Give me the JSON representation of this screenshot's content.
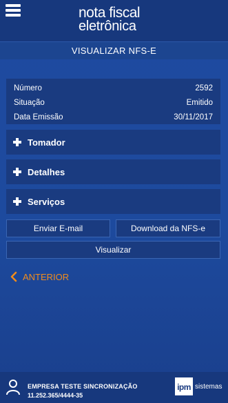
{
  "header": {
    "logo_line1": "nota fiscal",
    "logo_line2": "eletrônica"
  },
  "subheader": {
    "title": "VISUALIZAR NFS-E"
  },
  "info": [
    {
      "label": "Número",
      "value": "2592"
    },
    {
      "label": "Situação",
      "value": "Emitido"
    },
    {
      "label": "Data Emissão",
      "value": "30/11/2017"
    }
  ],
  "sections": [
    {
      "label": "Tomador"
    },
    {
      "label": "Detalhes"
    },
    {
      "label": "Serviços"
    }
  ],
  "actions": {
    "email": "Enviar E-mail",
    "download": "Download da NFS-e",
    "view": "Visualizar"
  },
  "back": {
    "label": "ANTERIOR"
  },
  "footer": {
    "company_name": "EMPRESA TESTE SINCRONIZAÇÃO",
    "company_cnpj": "11.252.365/4444-35",
    "brand_mark": "ipm",
    "brand_text": "sistemas"
  },
  "colors": {
    "accent": "#f08c1c",
    "panel": "#1a3b80",
    "background": "#1f4aa0"
  }
}
